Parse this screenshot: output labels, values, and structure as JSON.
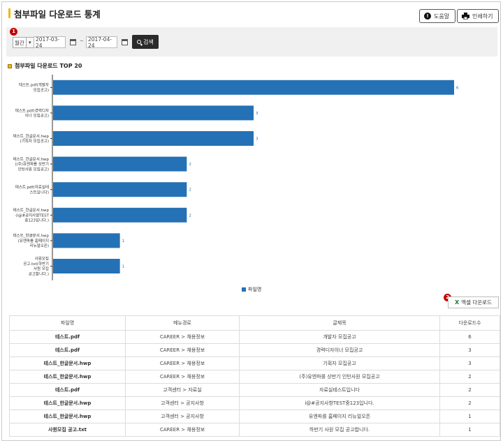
{
  "page": {
    "title": "첨부파일 다운로드 통계"
  },
  "toolbar": {
    "help_label": "도움말",
    "print_label": "인쇄하기"
  },
  "badges": {
    "one": "1",
    "two": "2"
  },
  "search": {
    "period_value": "월간",
    "start_date": "2017-03-24",
    "end_date": "2017-04-24",
    "tilde": "~",
    "search_label": "검색"
  },
  "chart_section": {
    "title": "첨부파일 다운로드 TOP 20"
  },
  "chart_data": {
    "type": "bar",
    "orientation": "horizontal",
    "title": "첨부파일 다운로드 TOP 20",
    "categories": [
      [
        "테스트.pdf(개발자",
        "모집공고)"
      ],
      [
        "테스트.pdf(경력디자",
        "이너 모집공고)"
      ],
      [
        "테스트_한글문서.hwp",
        "(기획자 모집공고)"
      ],
      [
        "테스트_한글문서.hwp",
        "((주)유엔파를 상반기",
        "인턴사원 모집공고)"
      ],
      [
        "테스트.pdf(자료실테",
        "스트입니다)"
      ],
      [
        "테스트_한글문서.hwp",
        "(i@#공지사항TEST",
        "중123입니다.)"
      ],
      [
        "테스트_한글문서.hwp",
        "(유엔파를 홈페이지",
        "리뉴얼오픈)"
      ],
      [
        "사원모집",
        "공고.txt(하반기",
        "사원 모집",
        "공고합니다.)"
      ]
    ],
    "series": [
      {
        "name": "파일명",
        "values": [
          6,
          3,
          3,
          2,
          2,
          2,
          1,
          1
        ]
      }
    ],
    "xlim": [
      0,
      6
    ],
    "grid": false,
    "legend": "bottom",
    "bar_color": "#2571b5"
  },
  "export": {
    "excel_label": "엑셀 다운로드"
  },
  "table": {
    "headers": [
      "파일명",
      "메뉴경로",
      "글제목",
      "다운로드수"
    ],
    "rows": [
      [
        "테스트.pdf",
        "CAREER > 채용정보",
        "개발자 모집공고",
        "6"
      ],
      [
        "테스트.pdf",
        "CAREER > 채용정보",
        "경력디자이너 모집공고",
        "3"
      ],
      [
        "테스트_한글문서.hwp",
        "CAREER > 채용정보",
        "기획자 모집공고",
        "3"
      ],
      [
        "테스트_한글문서.hwp",
        "CAREER > 채용정보",
        "(주)유엔파를 상반기 인턴사원 모집공고",
        "2"
      ],
      [
        "테스트.pdf",
        "고객센터 > 자료실",
        "자료실테스트입니다",
        "2"
      ],
      [
        "테스트_한글문서.hwp",
        "고객센터 > 공지사항",
        "i@#공지사항TEST중123입니다.",
        "2"
      ],
      [
        "테스트_한글문서.hwp",
        "고객센터 > 공지사항",
        "유엔파를 홈페이지 리뉴얼오픈",
        "1"
      ],
      [
        "사원모집 공고.txt",
        "CAREER > 채용정보",
        "하반기 사원 모집 공고합니다.",
        "1"
      ]
    ]
  }
}
